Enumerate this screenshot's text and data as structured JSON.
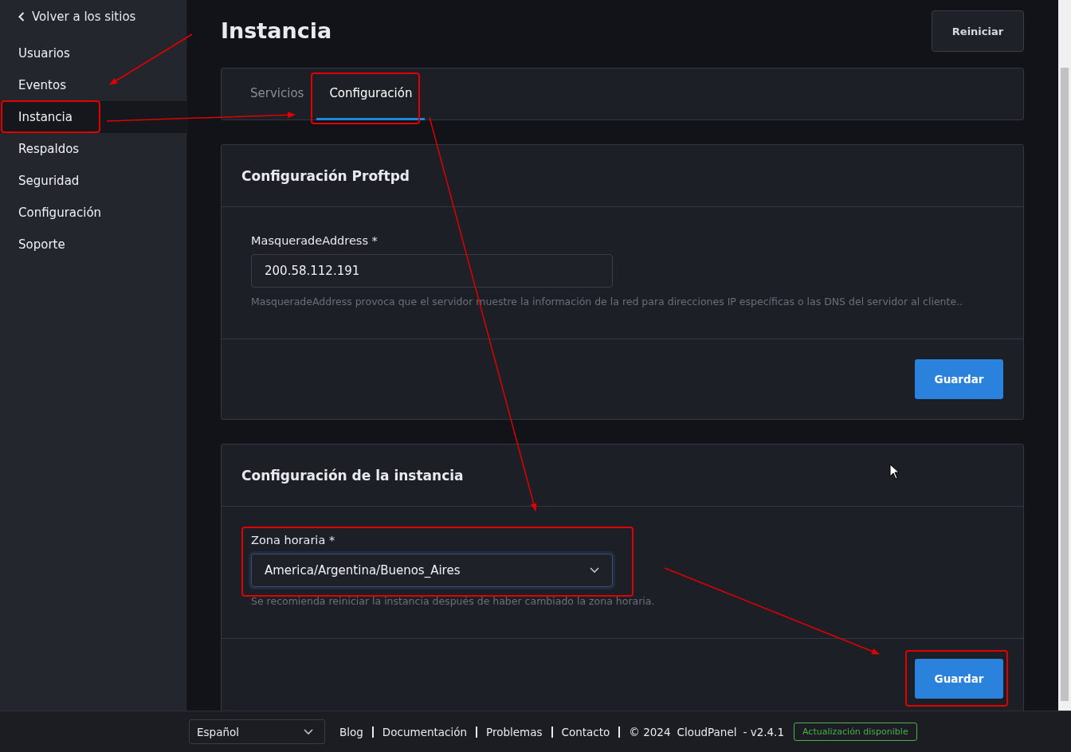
{
  "sidebar": {
    "back_link": "Volver a los sitios",
    "items": [
      {
        "label": "Usuarios",
        "selected": false
      },
      {
        "label": "Eventos",
        "selected": false
      },
      {
        "label": "Instancia",
        "selected": true
      },
      {
        "label": "Respaldos",
        "selected": false
      },
      {
        "label": "Seguridad",
        "selected": false
      },
      {
        "label": "Configuración",
        "selected": false
      },
      {
        "label": "Soporte",
        "selected": false
      }
    ]
  },
  "header": {
    "title": "Instancia",
    "button": "Reiniciar"
  },
  "tabs": [
    {
      "label": "Servicios",
      "selected": false
    },
    {
      "label": "Configuración",
      "selected": true
    }
  ],
  "cards": [
    {
      "title": "Configuración Proftpd",
      "field": {
        "kind": "text",
        "label": "MasqueradeAddress *",
        "value": "200.58.112.191",
        "help": "MasqueradeAddress provoca que el servidor muestre la información de la red para direcciones IP específicas o las DNS del servidor al cliente.."
      },
      "button": "Guardar"
    },
    {
      "title": "Configuración de la instancia",
      "field": {
        "kind": "select",
        "label": "Zona horaria *",
        "value": "America/Argentina/Buenos_Aires",
        "help": "Se recomienda reiniciar la instancia después de haber cambiado la zona horaria."
      },
      "button": "Guardar"
    }
  ],
  "footer": {
    "language": "Español",
    "links": [
      "Blog",
      "Documentación",
      "Problemas",
      "Contacto"
    ],
    "copyright": "© 2024",
    "product": "CloudPanel",
    "version": "- v2.4.1",
    "update_badge": "Actualización disponible"
  }
}
